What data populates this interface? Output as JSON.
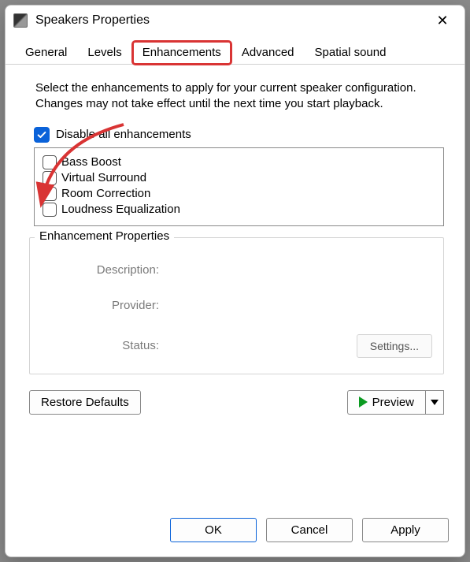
{
  "window": {
    "title": "Speakers Properties"
  },
  "tabs": {
    "general": "General",
    "levels": "Levels",
    "enhancements": "Enhancements",
    "advanced": "Advanced",
    "spatial": "Spatial sound"
  },
  "intro_text": "Select the enhancements to apply for your current speaker configuration. Changes may not take effect until the next time you start playback.",
  "disable_all": {
    "label": "Disable all enhancements",
    "checked": true
  },
  "enhancements": [
    {
      "label": "Bass Boost"
    },
    {
      "label": "Virtual Surround"
    },
    {
      "label": "Room Correction"
    },
    {
      "label": "Loudness Equalization"
    }
  ],
  "props": {
    "group_title": "Enhancement Properties",
    "desc_label": "Description:",
    "provider_label": "Provider:",
    "status_label": "Status:",
    "settings_btn": "Settings..."
  },
  "middle": {
    "restore": "Restore Defaults",
    "preview": "Preview"
  },
  "footer": {
    "ok": "OK",
    "cancel": "Cancel",
    "apply": "Apply"
  }
}
